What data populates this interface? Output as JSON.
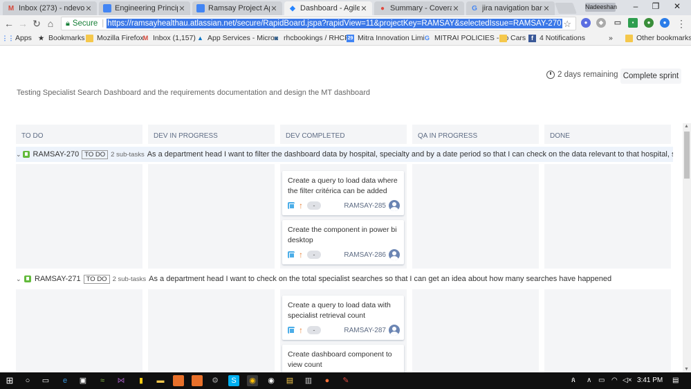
{
  "browser": {
    "tabs": [
      {
        "title": "Inbox (273) - ndevon@",
        "icon": "gmail-icon",
        "icon_color": "#d44638",
        "glyph": "M",
        "active": false
      },
      {
        "title": "Engineering Principles",
        "icon": "docs-icon",
        "icon_color": "#4285f4",
        "glyph": "",
        "active": false
      },
      {
        "title": "Ramsay Project Appro",
        "icon": "docs-icon",
        "icon_color": "#4285f4",
        "glyph": "",
        "active": false
      },
      {
        "title": "Dashboard - Agile Boa",
        "icon": "jira-icon",
        "icon_color": "#2684ff",
        "glyph": "◆",
        "active": true
      },
      {
        "title": "Summary - Coverage I",
        "icon": "sonar-icon",
        "icon_color": "#e04a3f",
        "glyph": "●",
        "active": false
      },
      {
        "title": "jira navigation bar dis",
        "icon": "google-icon",
        "icon_color": "#4285f4",
        "glyph": "G",
        "active": false
      }
    ],
    "profile_name": "Nadeeshan",
    "secure_label": "Secure",
    "url": "https://ramsayhealthau.atlassian.net/secure/RapidBoard.jspa?rapidView=11&projectKey=RAMSAY&selectedIssue=RAMSAY-270",
    "bookmarks": [
      {
        "label": "Apps",
        "icon": "apps-icon"
      },
      {
        "label": "Bookmarks",
        "icon": "star-icon"
      },
      {
        "label": "Mozilla Firefox",
        "icon": "folder-icon"
      },
      {
        "label": "Inbox (1,157)",
        "icon": "gmail-icon"
      },
      {
        "label": "App Services - Micro",
        "icon": "azure-icon"
      },
      {
        "label": "rhcbookings / RHCPo",
        "icon": "bitbucket-icon"
      },
      {
        "label": "Mitra Innovation Limi",
        "icon": "calendar-icon"
      },
      {
        "label": "MITRAI POLICIES - co",
        "icon": "google-icon"
      },
      {
        "label": "Cars",
        "icon": "folder-icon"
      },
      {
        "label": "4 Notifications",
        "icon": "facebook-icon"
      }
    ],
    "more_bookmarks": "»",
    "other_bookmarks": "Other bookmarks"
  },
  "board": {
    "days_remaining": "2 days remaining",
    "complete_sprint": "Complete sprint",
    "sprint_goal": "Testing Specialist Search Dashboard and the requirements documentation and design the MT dashboard",
    "columns": [
      "TO DO",
      "DEV IN PROGRESS",
      "DEV COMPLETED",
      "QA IN PROGRESS",
      "DONE"
    ],
    "swimlanes": [
      {
        "key": "RAMSAY-270",
        "status": "TO DO",
        "subtasks": "2 sub-tasks",
        "summary": "As a department head I want to filter the dashboard data by hospital, specialty and by a date period so that I can check on the data relevant to that hospital, specialty and",
        "cards": [
          {
            "text": "Create a query to load data where the filter critérica can be added",
            "key": "RAMSAY-285",
            "estimate": "-"
          },
          {
            "text": "Create the component in power bi desktop",
            "key": "RAMSAY-286",
            "estimate": "-"
          }
        ]
      },
      {
        "key": "RAMSAY-271",
        "status": "TO DO",
        "subtasks": "2 sub-tasks",
        "summary": "As a department head I want to check on the total specialist searches so that I can get an idea about how many searches have happened",
        "cards": [
          {
            "text": "Create a query to load data with specialist retrieval count",
            "key": "RAMSAY-287",
            "estimate": "-"
          },
          {
            "text": "Create dashboard component to view count",
            "key": "",
            "estimate": ""
          }
        ]
      }
    ]
  },
  "taskbar": {
    "time": "3:41 PM"
  }
}
